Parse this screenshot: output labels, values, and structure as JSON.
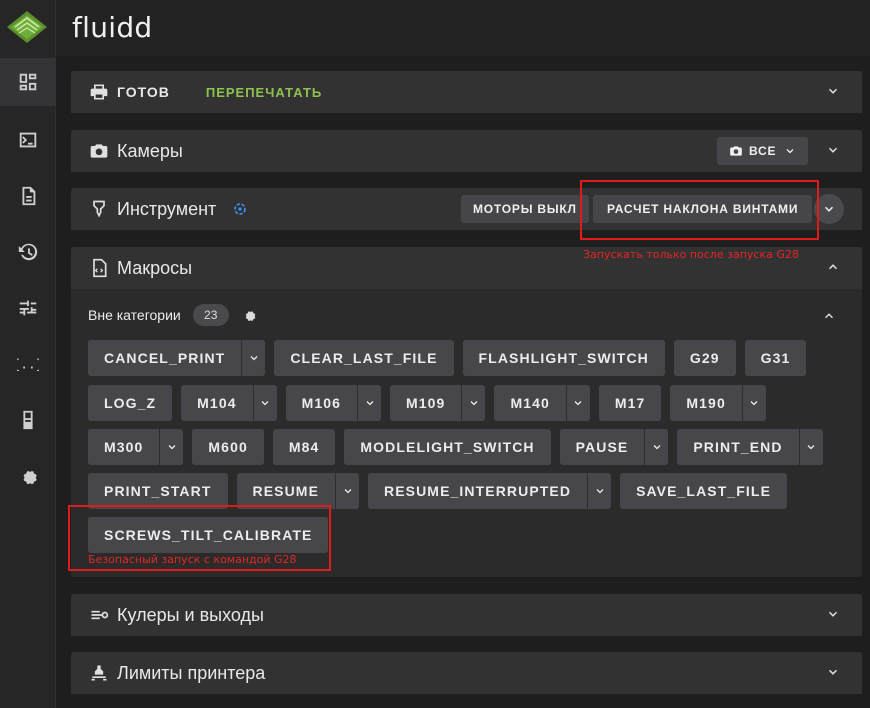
{
  "app": {
    "brand": "fluidd"
  },
  "sidebar": {
    "items": [
      {
        "name": "dashboard",
        "icon": "dashboard-icon"
      },
      {
        "name": "console",
        "icon": "console-icon"
      },
      {
        "name": "jobs",
        "icon": "file-document-icon"
      },
      {
        "name": "history",
        "icon": "history-icon"
      },
      {
        "name": "tune",
        "icon": "tune-icon"
      },
      {
        "name": "config",
        "icon": "code-braces-icon"
      },
      {
        "name": "system",
        "icon": "device-icon"
      },
      {
        "name": "settings",
        "icon": "gear-icon"
      }
    ]
  },
  "status_panel": {
    "title": "Готов",
    "action": "ПЕРЕПЕЧАТАТЬ"
  },
  "cameras_panel": {
    "title": "Камеры",
    "filter_label": "ВСЕ"
  },
  "tool_panel": {
    "title": "Инструмент",
    "motors_off": "МОТОРЫ ВЫКЛ",
    "screws_tilt": "РАСЧЕТ НАКЛОНА ВИНТАМИ",
    "annotation": "Запускать только после запуска G28"
  },
  "macros_panel": {
    "title": "Макросы",
    "category": "Вне категории",
    "count": "23",
    "annotation": "Безопасный запуск с командой G28",
    "rows": [
      [
        {
          "label": "CANCEL_PRINT",
          "dropdown": true
        },
        {
          "label": "CLEAR_LAST_FILE",
          "dropdown": false
        },
        {
          "label": "FLASHLIGHT_SWITCH",
          "dropdown": false
        },
        {
          "label": "G29",
          "dropdown": false
        },
        {
          "label": "G31",
          "dropdown": false
        }
      ],
      [
        {
          "label": "LOG_Z",
          "dropdown": false
        },
        {
          "label": "M104",
          "dropdown": true
        },
        {
          "label": "M106",
          "dropdown": true
        },
        {
          "label": "M109",
          "dropdown": true
        },
        {
          "label": "M140",
          "dropdown": true
        },
        {
          "label": "M17",
          "dropdown": false
        },
        {
          "label": "M190",
          "dropdown": true
        }
      ],
      [
        {
          "label": "M300",
          "dropdown": true
        },
        {
          "label": "M600",
          "dropdown": false
        },
        {
          "label": "M84",
          "dropdown": false
        },
        {
          "label": "MODLELIGHT_SWITCH",
          "dropdown": false
        },
        {
          "label": "PAUSE",
          "dropdown": true
        },
        {
          "label": "PRINT_END",
          "dropdown": true
        }
      ],
      [
        {
          "label": "PRINT_START",
          "dropdown": false
        },
        {
          "label": "RESUME",
          "dropdown": true
        },
        {
          "label": "RESUME_INTERRUPTED",
          "dropdown": true
        },
        {
          "label": "SAVE_LAST_FILE",
          "dropdown": false
        }
      ],
      [
        {
          "label": "SCREWS_TILT_CALIBRATE",
          "dropdown": false
        }
      ]
    ]
  },
  "fans_panel": {
    "title": "Кулеры и выходы"
  },
  "limits_panel": {
    "title": "Лимиты принтера"
  },
  "colors": {
    "accent_green": "#8ec150",
    "annotation_red": "#e01b1b",
    "tool_icon_blue": "#3f8ef0"
  }
}
